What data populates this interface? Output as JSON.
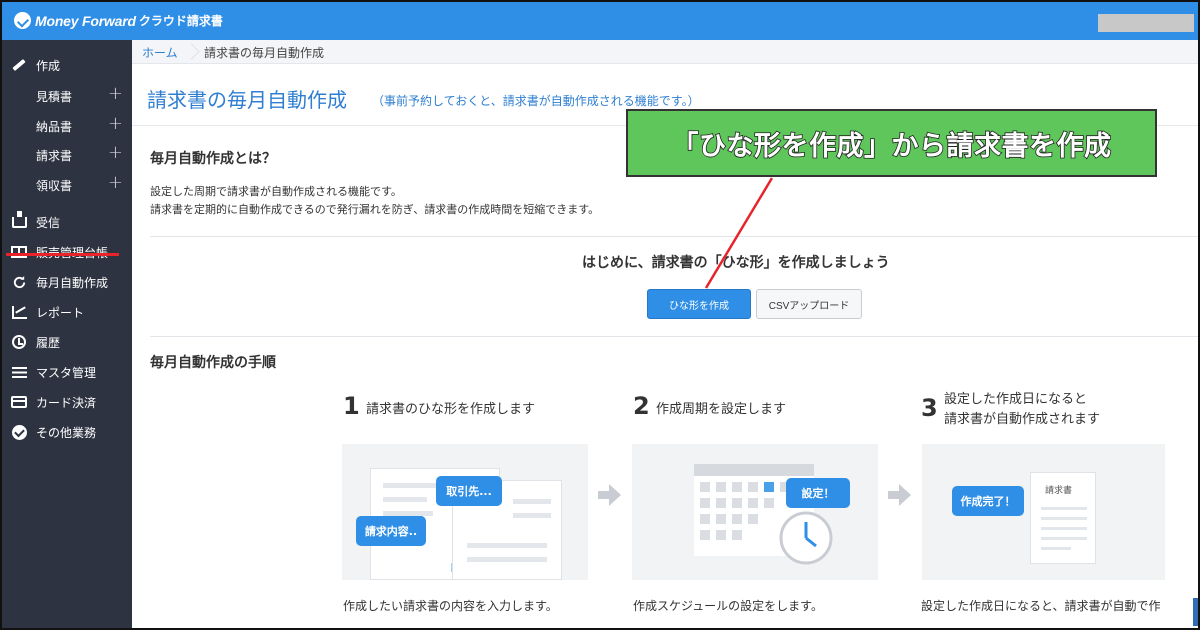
{
  "header": {
    "brand": "Money Forward",
    "product": "クラウド請求書"
  },
  "sidebar": {
    "items": [
      {
        "label": "作成",
        "icon": "pen-icon"
      },
      {
        "label": "見積書",
        "sub": true
      },
      {
        "label": "納品書",
        "sub": true
      },
      {
        "label": "請求書",
        "sub": true
      },
      {
        "label": "領収書",
        "sub": true
      },
      {
        "label": "受信",
        "icon": "inbox-icon"
      },
      {
        "label": "販売管理台帳",
        "icon": "ledger-icon"
      },
      {
        "label": "毎月自動作成",
        "icon": "refresh-icon",
        "active": true
      },
      {
        "label": "レポート",
        "icon": "chart-icon"
      },
      {
        "label": "履歴",
        "icon": "history-icon"
      },
      {
        "label": "マスタ管理",
        "icon": "list-icon"
      },
      {
        "label": "カード決済",
        "icon": "card-icon"
      },
      {
        "label": "その他業務",
        "icon": "moneyforward-icon"
      }
    ],
    "plus": "+"
  },
  "breadcrumb": {
    "home": "ホーム",
    "current": "請求書の毎月自動作成"
  },
  "page": {
    "title": "請求書の毎月自動作成",
    "description": "（事前予約しておくと、請求書が自動作成される機能です。）"
  },
  "about": {
    "title": "毎月自動作成とは？",
    "lines": [
      "設定した周期で請求書が自動作成される機能です。",
      "請求書を定期的に自動作成できるので発行漏れを防ぎ、請求書の作成時間を短縮できます。"
    ]
  },
  "cta": {
    "text": "はじめに、請求書の「ひな形」を作成しましょう",
    "primary_button": "ひな形を作成",
    "secondary_button": "CSVアップロード"
  },
  "steps": {
    "title": "毎月自動作成の手順",
    "items": [
      {
        "num": "1",
        "lines": [
          "請求書のひな形を作成します"
        ],
        "caption": "作成したい請求書の内容を入力します。",
        "bubbles": [
          "取引先...",
          "請求内容.."
        ]
      },
      {
        "num": "2",
        "lines": [
          "作成周期を設定します"
        ],
        "caption": "作成スケジュールの設定をします。",
        "bubbles": [
          "設定！"
        ]
      },
      {
        "num": "3",
        "lines": [
          "設定した作成日になると",
          "請求書が自動作成されます"
        ],
        "caption": "設定した作成日になると、請求書が自動で作",
        "bubbles": [
          "作成完了！"
        ],
        "doc_title": "請求書"
      }
    ]
  },
  "callout": {
    "text": "「ひな形を作成」から請求書を作成",
    "color": "#5ec65a"
  },
  "colors": {
    "accent": "#2f8ee6",
    "sidebar": "#2d3341",
    "highlight": "#e8242a"
  }
}
